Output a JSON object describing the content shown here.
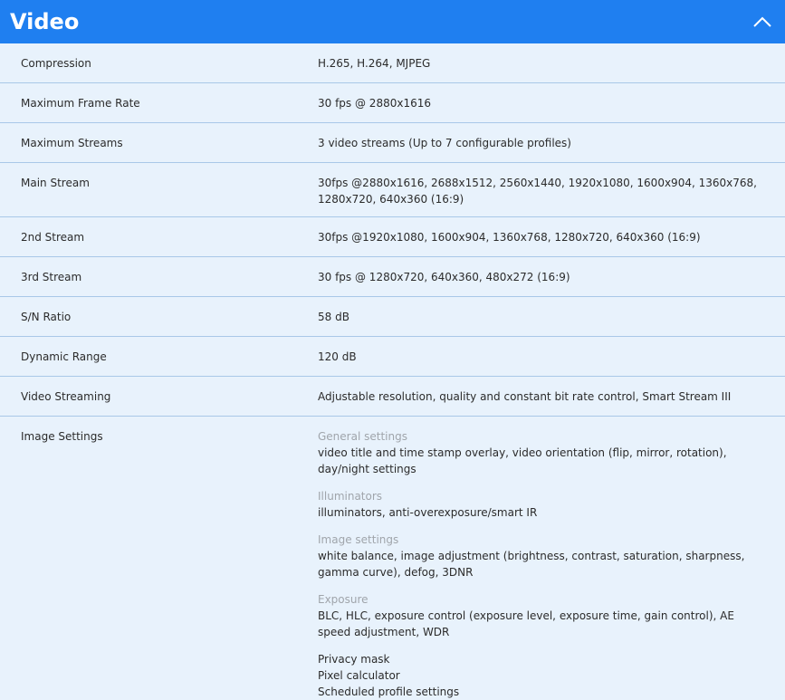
{
  "section": {
    "title": "Video",
    "collapse_icon": "chevron-up-icon",
    "header_color": "#1f7ff0",
    "body_color": "#e8f2fc"
  },
  "rows": [
    {
      "label": "Compression",
      "value": "H.265, H.264, MJPEG"
    },
    {
      "label": "Maximum Frame Rate",
      "value": "30 fps @ 2880x1616"
    },
    {
      "label": "Maximum Streams",
      "value": "3 video streams (Up to 7 configurable profiles)"
    },
    {
      "label": "Main Stream",
      "value": "30fps @2880x1616, 2688x1512, 2560x1440, 1920x1080, 1600x904, 1360x768, 1280x720, 640x360 (16:9)"
    },
    {
      "label": "2nd Stream",
      "value": "30fps @1920x1080, 1600x904, 1360x768, 1280x720, 640x360 (16:9)"
    },
    {
      "label": "3rd Stream",
      "value": "30 fps @ 1280x720, 640x360, 480x272 (16:9)"
    },
    {
      "label": "S/N Ratio",
      "value": "58 dB"
    },
    {
      "label": "Dynamic Range",
      "value": "120 dB"
    },
    {
      "label": "Video Streaming",
      "value": "Adjustable resolution, quality and constant bit rate control, Smart Stream III"
    }
  ],
  "image_settings": {
    "label": "Image Settings",
    "groups": [
      {
        "title": "General settings",
        "text": "video title and time stamp overlay, video orientation (flip, mirror, rotation), day/night settings"
      },
      {
        "title": "Illuminators",
        "text": "illuminators, anti-overexposure/smart IR"
      },
      {
        "title": "Image settings",
        "text": "white balance, image adjustment (brightness, contrast, saturation, sharpness, gamma curve), defog, 3DNR"
      },
      {
        "title": "Exposure",
        "text": "BLC, HLC, exposure control (exposure level, exposure time, gain control), AE speed adjustment, WDR"
      }
    ],
    "extra_lines": [
      "Privacy mask",
      "Pixel calculator",
      "Scheduled profile settings"
    ]
  }
}
